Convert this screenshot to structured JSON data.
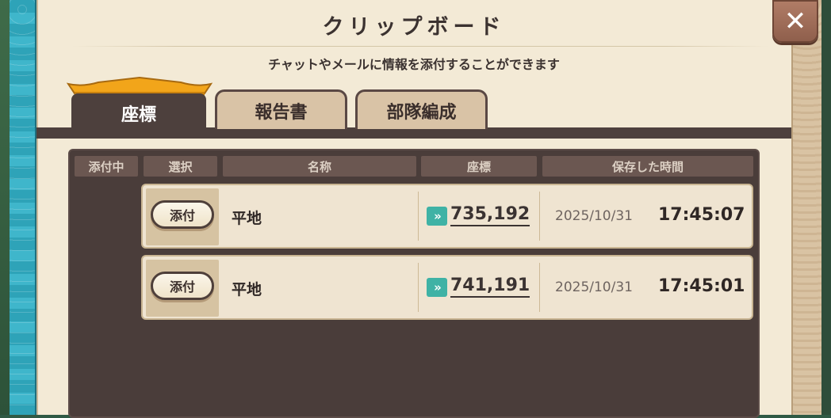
{
  "window": {
    "title": "クリップボード",
    "subtitle": "チャットやメールに情報を添付することができます",
    "close_label": "✕"
  },
  "tabs": [
    {
      "label": "座標",
      "active": true
    },
    {
      "label": "報告書",
      "active": false
    },
    {
      "label": "部隊編成",
      "active": false
    }
  ],
  "table": {
    "headers": {
      "attached": "添付中",
      "select": "選択",
      "name": "名称",
      "coords": "座標",
      "saved_time": "保存した時間"
    },
    "rows": [
      {
        "button": "添付",
        "name": "平地",
        "coords": "735,192",
        "date": "2025/10/31",
        "time": "17:45:07"
      },
      {
        "button": "添付",
        "name": "平地",
        "coords": "741,191",
        "date": "2025/10/31",
        "time": "17:45:01"
      }
    ]
  },
  "icons": {
    "close": "close-icon",
    "coords_jump": "double-chevron-right-icon"
  },
  "colors": {
    "panel_bg": "#f3ead6",
    "table_bg": "#4a3d3a",
    "accent_teal": "#3fb2a5",
    "tab_roof": "#f2a51a"
  }
}
